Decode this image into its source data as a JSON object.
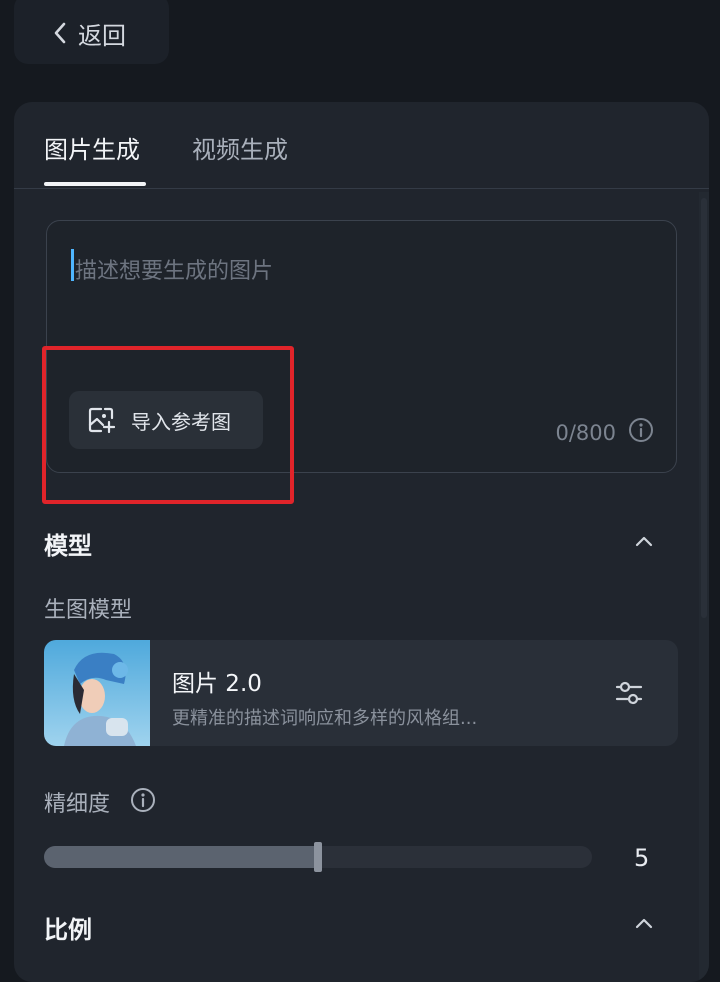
{
  "header": {
    "back_label": "返回"
  },
  "tabs": [
    {
      "label": "图片生成",
      "active": true
    },
    {
      "label": "视频生成",
      "active": false
    }
  ],
  "prompt": {
    "placeholder": "描述想要生成的图片",
    "char_count": "0/800",
    "import_reference_label": "导入参考图"
  },
  "model_section": {
    "title": "模型",
    "sub_label": "生图模型",
    "card": {
      "name": "图片 2.0",
      "description": "更精准的描述词响应和多样的风格组..."
    }
  },
  "detail": {
    "label": "精细度",
    "value": "5",
    "level_fraction": 0.5
  },
  "ratio_section": {
    "title": "比例"
  },
  "colors": {
    "background": "#15191f",
    "panel": "#20252d",
    "highlight": "#e0242a",
    "cursor": "#4fb6ff"
  },
  "icons": [
    "chevron-left-icon",
    "image-add-icon",
    "info-icon",
    "chevron-up-icon",
    "sliders-icon"
  ]
}
